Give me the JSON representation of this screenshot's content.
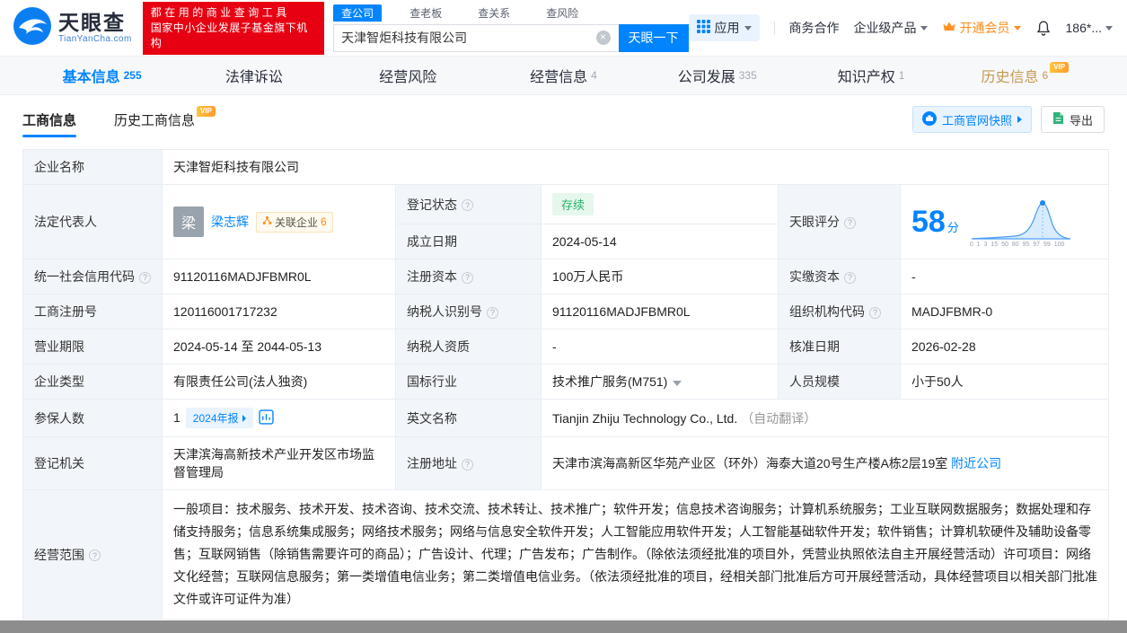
{
  "header": {
    "logo": {
      "brand": "天眼查",
      "domain": "TianYanCha.com"
    },
    "promo": {
      "line1": "都在用的商业查询工具",
      "line2": "国家中小企业发展子基金旗下机构"
    },
    "search": {
      "tab_company": "查公司",
      "tab_boss": "查老板",
      "tab_relation": "查关系",
      "tab_risk": "查风险",
      "value": "天津智炬科技有限公司",
      "button": "天眼一下"
    },
    "menu": {
      "apps": "应用",
      "cooperation": "商务合作",
      "enterprise": "企业级产品",
      "vip": "开通会员",
      "phone": "186*..."
    }
  },
  "nav": {
    "tabs": [
      {
        "label": "基本信息",
        "count": "255"
      },
      {
        "label": "法律诉讼",
        "count": ""
      },
      {
        "label": "经营风险",
        "count": ""
      },
      {
        "label": "经营信息",
        "count": "4"
      },
      {
        "label": "公司发展",
        "count": "335"
      },
      {
        "label": "知识产权",
        "count": "1"
      },
      {
        "label": "历史信息",
        "count": "6"
      }
    ]
  },
  "tabs": {
    "business_info": "工商信息",
    "history_business_info": "历史工商信息",
    "vip_badge": "VIP",
    "snapshot_button": "工商官网快照",
    "export_button": "导出"
  },
  "company": {
    "name_label": "企业名称",
    "name": "天津智炬科技有限公司",
    "legal_rep_label": "法定代表人",
    "legal_rep_avatar": "梁",
    "legal_rep_name": "梁志辉",
    "related_label": "关联企业",
    "related_count": "6",
    "reg_status_label": "登记状态",
    "reg_status": "存续",
    "establish_label": "成立日期",
    "establish_date": "2024-05-14",
    "score_label": "天眼评分",
    "score": "58",
    "score_unit": "分",
    "score_axis": "0 1 3 15 50 80 95 97 99 100",
    "credit_code_label": "统一社会信用代码",
    "credit_code": "91120116MADJFBMR0L",
    "reg_capital_label": "注册资本",
    "reg_capital": "100万人民币",
    "paid_capital_label": "实缴资本",
    "paid_capital": "-",
    "reg_number_label": "工商注册号",
    "reg_number": "120116001717232",
    "taxpayer_id_label": "纳税人识别号",
    "taxpayer_id": "91120116MADJFBMR0L",
    "org_code_label": "组织机构代码",
    "org_code": "MADJFBMR-0",
    "business_term_label": "营业期限",
    "business_term": "2024-05-14 至 2044-05-13",
    "taxpayer_quality_label": "纳税人资质",
    "taxpayer_quality": "-",
    "approval_date_label": "核准日期",
    "approval_date": "2026-02-28",
    "company_type_label": "企业类型",
    "company_type": "有限责任公司(法人独资)",
    "industry_label": "国标行业",
    "industry": "技术推广服务(M751)",
    "staff_size_label": "人员规模",
    "staff_size": "小于50人",
    "insured_label": "参保人数",
    "insured_count": "1",
    "annual_report_badge": "2024年报",
    "english_name_label": "英文名称",
    "english_name": "Tianjin Zhiju Technology Co., Ltd.",
    "english_name_note": "（自动翻译）",
    "reg_authority_label": "登记机关",
    "reg_authority": "天津滨海高新技术产业开发区市场监督管理局",
    "address_label": "注册地址",
    "address": "天津市滨海高新区华苑产业区（环外）海泰大道20号生产楼A栋2层19室",
    "nearby_link": "附近公司",
    "business_scope_label": "经营范围",
    "business_scope": "一般项目：技术服务、技术开发、技术咨询、技术交流、技术转让、技术推广；软件开发；信息技术咨询服务；计算机系统服务；工业互联网数据服务；数据处理和存储支持服务；信息系统集成服务；网络技术服务；网络与信息安全软件开发；人工智能应用软件开发；人工智能基础软件开发；软件销售；计算机软硬件及辅助设备零售；互联网销售（除销售需要许可的商品）；广告设计、代理；广告发布；广告制作。（除依法须经批准的项目外，凭营业执照依法自主开展经营活动）许可项目：网络文化经营；互联网信息服务；第一类增值电信业务；第二类增值电信业务。（依法须经批准的项目，经相关部门批准后方可开展经营活动，具体经营项目以相关部门批准文件或许可证件为准）"
  }
}
